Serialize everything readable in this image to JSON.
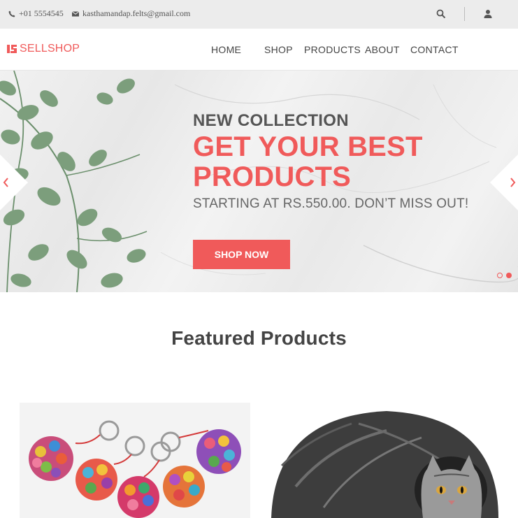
{
  "topbar": {
    "phone": "+01 5554545",
    "email": "kasthamandap.felts@gmail.com",
    "icons": {
      "phone": "phone-icon",
      "email": "mail-icon",
      "search": "search-icon",
      "user": "user-icon"
    }
  },
  "header": {
    "logo_text": "SELLSHOP",
    "nav": [
      "HOME",
      "SHOP",
      "PRODUCTS",
      "ABOUT",
      "CONTACT"
    ]
  },
  "hero": {
    "kicker": "NEW COLLECTION",
    "headline": "GET YOUR BEST PRODUCTS",
    "subtitle": "STARTING AT RS.550.00. DON’T MISS OUT!",
    "cta": "SHOP NOW",
    "slides_total": 2,
    "active_slide": 2
  },
  "featured": {
    "title": "Featured Products",
    "products": [
      {
        "image": "felt ball keychains"
      },
      {
        "image": "felt cat cave with cat"
      }
    ]
  },
  "colors": {
    "accent": "#f05a5a",
    "topbar_bg": "#ececec",
    "text": "#444444"
  }
}
